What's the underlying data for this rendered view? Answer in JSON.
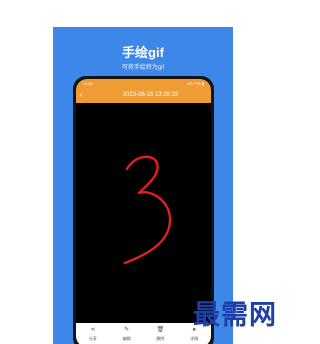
{
  "promo": {
    "title": "手绘gif",
    "subtitle": "可将手绘转为gif"
  },
  "status_bar": {
    "time": "11:36",
    "signal": "4G ⁸⁹% ▮"
  },
  "header": {
    "back_icon": "back-arrow-icon",
    "title": "2023-06-15 13:28:32"
  },
  "canvas": {
    "background": "#000000",
    "stroke_color": "#e01f1f",
    "drawing": "3"
  },
  "toolbar": [
    {
      "icon": "share-icon",
      "glyph": "⋖",
      "label": "分享"
    },
    {
      "icon": "edit-icon",
      "glyph": "✎",
      "label": "编辑"
    },
    {
      "icon": "delete-icon",
      "glyph": "🗑",
      "label": "删除"
    },
    {
      "icon": "info-icon",
      "glyph": "●",
      "label": "详情"
    }
  ],
  "watermark": "最需网",
  "colors": {
    "promo_bg": "#3d87e8",
    "header_bg": "#ef9c34",
    "watermark": "#1e3ea8"
  }
}
